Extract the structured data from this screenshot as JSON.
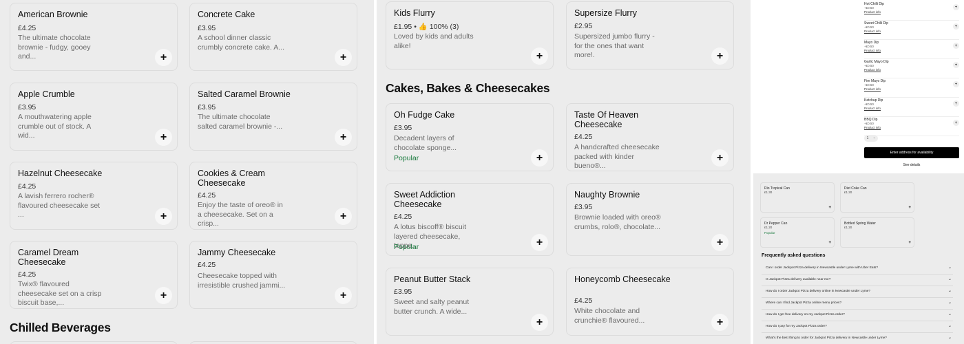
{
  "panel1": {
    "cards": [
      {
        "title": "American Brownie",
        "price": "£4.25",
        "desc": "The ultimate chocolate brownie - fudgy, gooey and..."
      },
      {
        "title": "Concrete Cake",
        "price": "£3.95",
        "desc": "A school dinner classic crumbly concrete cake. A..."
      },
      {
        "title": "Apple Crumble",
        "price": "£3.95",
        "desc": "A mouthwatering apple crumble out of stock. A wid..."
      },
      {
        "title": "Salted Caramel Brownie",
        "price": "£3.95",
        "desc": "The ultimate chocolate salted caramel brownie -..."
      },
      {
        "title": "Hazelnut Cheesecake",
        "price": "£4.25",
        "desc": "A lavish ferrero rocher® flavoured cheesecake set ..."
      },
      {
        "title": "Cookies & Cream Cheesecake",
        "price": "£4.25",
        "desc": "Enjoy the taste of oreo® in a cheesecake. Set on a crisp..."
      },
      {
        "title": "Caramel Dream Cheesecake",
        "price": "£4.25",
        "desc": "Twix® flavoured cheesecake set on a crisp biscuit base,..."
      },
      {
        "title": "Jammy Cheesecake",
        "price": "£4.25",
        "desc": "Cheesecake topped with irresistible crushed jammi..."
      }
    ],
    "section_heading": "Chilled Beverages",
    "add_symbol": "+"
  },
  "panel2": {
    "cards_top": [
      {
        "title": "Kids Flurry",
        "price": "£1.95 • 👍 100% (3)",
        "desc": "Loved by kids and adults alike!"
      },
      {
        "title": "Supersize Flurry",
        "price": "£2.95",
        "desc": "Supersized jumbo flurry - for the ones that want more!."
      }
    ],
    "section_heading": "Cakes, Bakes & Cheesecakes",
    "cards": [
      {
        "title": "Oh Fudge Cake",
        "price": "£3.95",
        "desc": "Decadent layers of chocolate sponge...",
        "tag": "Popular"
      },
      {
        "title": "Taste Of Heaven Cheesecake",
        "price": "£4.25",
        "desc": "A handcrafted cheesecake packed with kinder bueno®...",
        "tag": ""
      },
      {
        "title": "Sweet Addiction Cheesecake",
        "price": "£4.25",
        "desc": "A lotus biscoff® biscuit layered cheesecake, toppe...",
        "tag": "Popular"
      },
      {
        "title": "Naughty Brownie",
        "price": "£3.95",
        "desc": "Brownie loaded with oreo® crumbs, rolo®, chocolate...",
        "tag": ""
      },
      {
        "title": "Peanut Butter Stack",
        "price": "£3.95",
        "desc": "Sweet and salty peanut butter crunch. A wide...",
        "tag": ""
      },
      {
        "title": "Honeycomb Cheesecake",
        "price": "£4.25",
        "desc": "White chocolate and crunchie® flavoured...",
        "tag": ""
      }
    ]
  },
  "panel3": {
    "dips": [
      {
        "name": "Hot Chilli Dip",
        "price": "+£0.50",
        "link": "Product info"
      },
      {
        "name": "Sweet Chilli Dip",
        "price": "+£0.50",
        "link": "Product info"
      },
      {
        "name": "Mayo Dip",
        "price": "+£0.50",
        "link": "Product info"
      },
      {
        "name": "Garlic Mayo Dip",
        "price": "+£0.50",
        "link": "Product info"
      },
      {
        "name": "Fire Mayo Dip",
        "price": "+£0.50",
        "link": "Product info"
      },
      {
        "name": "Ketchup Dip",
        "price": "+£0.50",
        "link": "Product info"
      },
      {
        "name": "BBQ Dip",
        "price": "+£0.50",
        "link": "Product info"
      }
    ],
    "stepper": {
      "qty": "1",
      "minus": "−"
    },
    "cta_label": "Enter address for availability",
    "see_details": "See details",
    "beverages": [
      {
        "name": "Rio Tropical Can",
        "price": "£1.30",
        "tag": ""
      },
      {
        "name": "Diet Coke Can",
        "price": "£1.20",
        "tag": ""
      },
      {
        "name": "Dr Pepper Can",
        "price": "£1.20",
        "tag": "Popular"
      },
      {
        "name": "Bottled Spring Water",
        "price": "£1.20",
        "tag": ""
      }
    ],
    "faq_heading": "Frequently asked questions",
    "faqs": [
      "Can I order Jackpot Pizza delivery in Newcastle under Lyme with Uber Eats?",
      "Is Jackpot Pizza delivery available near me?",
      "How do I order Jackpot Pizza delivery online in Newcastle under Lyme?",
      "Where can I find Jackpot Pizza online menu prices?",
      "How do I get free delivery on my Jackpot Pizza order?",
      "How do I pay for my Jackpot Pizza order?",
      "What's the best thing to order for Jackpot Pizza delivery in Newcastle under Lyme?"
    ]
  }
}
